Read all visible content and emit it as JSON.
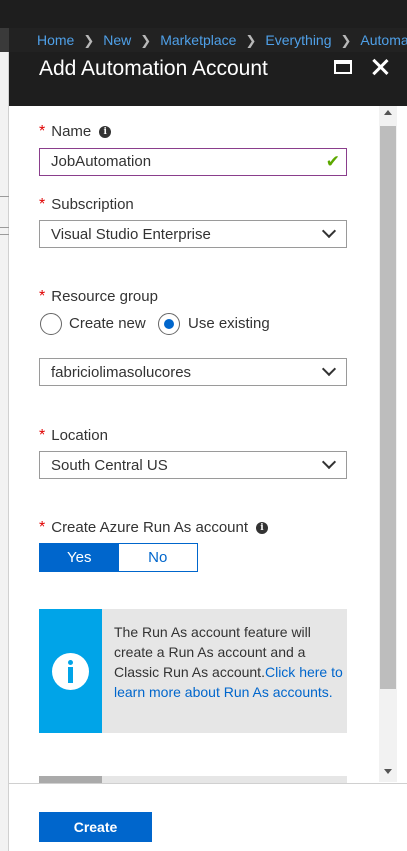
{
  "breadcrumb": [
    "Home",
    "New",
    "Marketplace",
    "Everything",
    "Automation"
  ],
  "blade": {
    "title": "Add Automation Account"
  },
  "form": {
    "name_label": "Name",
    "name_value": "JobAutomation",
    "subscription_label": "Subscription",
    "subscription_value": "Visual Studio Enterprise",
    "resource_group_label": "Resource group",
    "create_new_label": "Create new",
    "use_existing_label": "Use existing",
    "resource_group_selected": "use_existing",
    "resource_group_value": "fabriciolimasolucores",
    "location_label": "Location",
    "location_value": "South Central US",
    "run_as_label": "Create Azure Run As account",
    "yes_label": "Yes",
    "no_label": "No",
    "run_as_selected": "Yes"
  },
  "info": {
    "text": "The Run As account feature will create a Run As account and a Classic Run As account.",
    "link": "Click here to learn more about Run As accounts."
  },
  "footer": {
    "create_label": "Create"
  },
  "colors": {
    "accent": "#0066cc",
    "required": "#e00000",
    "info_bar": "#00a4e8",
    "valid": "#5ca800",
    "focus_border": "#8a3e8c"
  },
  "icons": [
    "info-icon",
    "check-icon",
    "chevron-down-icon",
    "maximize-icon",
    "close-icon"
  ]
}
